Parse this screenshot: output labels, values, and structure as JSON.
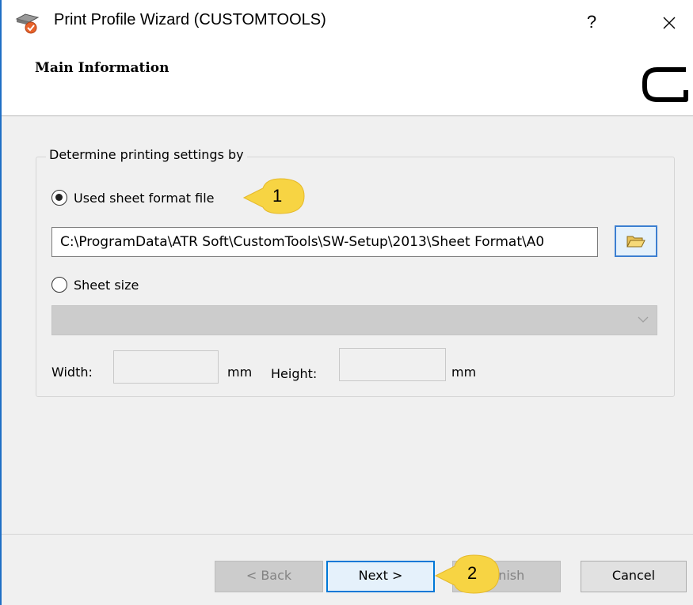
{
  "window": {
    "title": "Print Profile Wizard (CUSTOMTOOLS)",
    "help_glyph": "?",
    "close_icon": "close-icon"
  },
  "header": {
    "title": "Main Information",
    "logo_icon": "customtools-logo-icon"
  },
  "settings_group": {
    "legend": "Determine printing settings by",
    "option_format_file": {
      "label": "Used sheet format file",
      "selected": true
    },
    "format_file_path": "C:\\ProgramData\\ATR Soft\\CustomTools\\SW-Setup\\2013\\Sheet Format\\A0",
    "browse_icon": "folder-open-icon",
    "option_sheet_size": {
      "label": "Sheet size",
      "selected": false
    },
    "sheet_size_value": "",
    "width_label": "Width:",
    "width_value": "",
    "width_unit": "mm",
    "height_label": "Height:",
    "height_value": "",
    "height_unit": "mm"
  },
  "footer": {
    "back_label": "< Back",
    "next_label": "Next >",
    "finish_label": "Finish",
    "cancel_label": "Cancel"
  },
  "callouts": {
    "one": "1",
    "two": "2"
  },
  "colors": {
    "accent": "#0078d7",
    "callout_fill": "#f7d443",
    "body_bg": "#f0f0f0",
    "disabled_bg": "#cccccc"
  }
}
